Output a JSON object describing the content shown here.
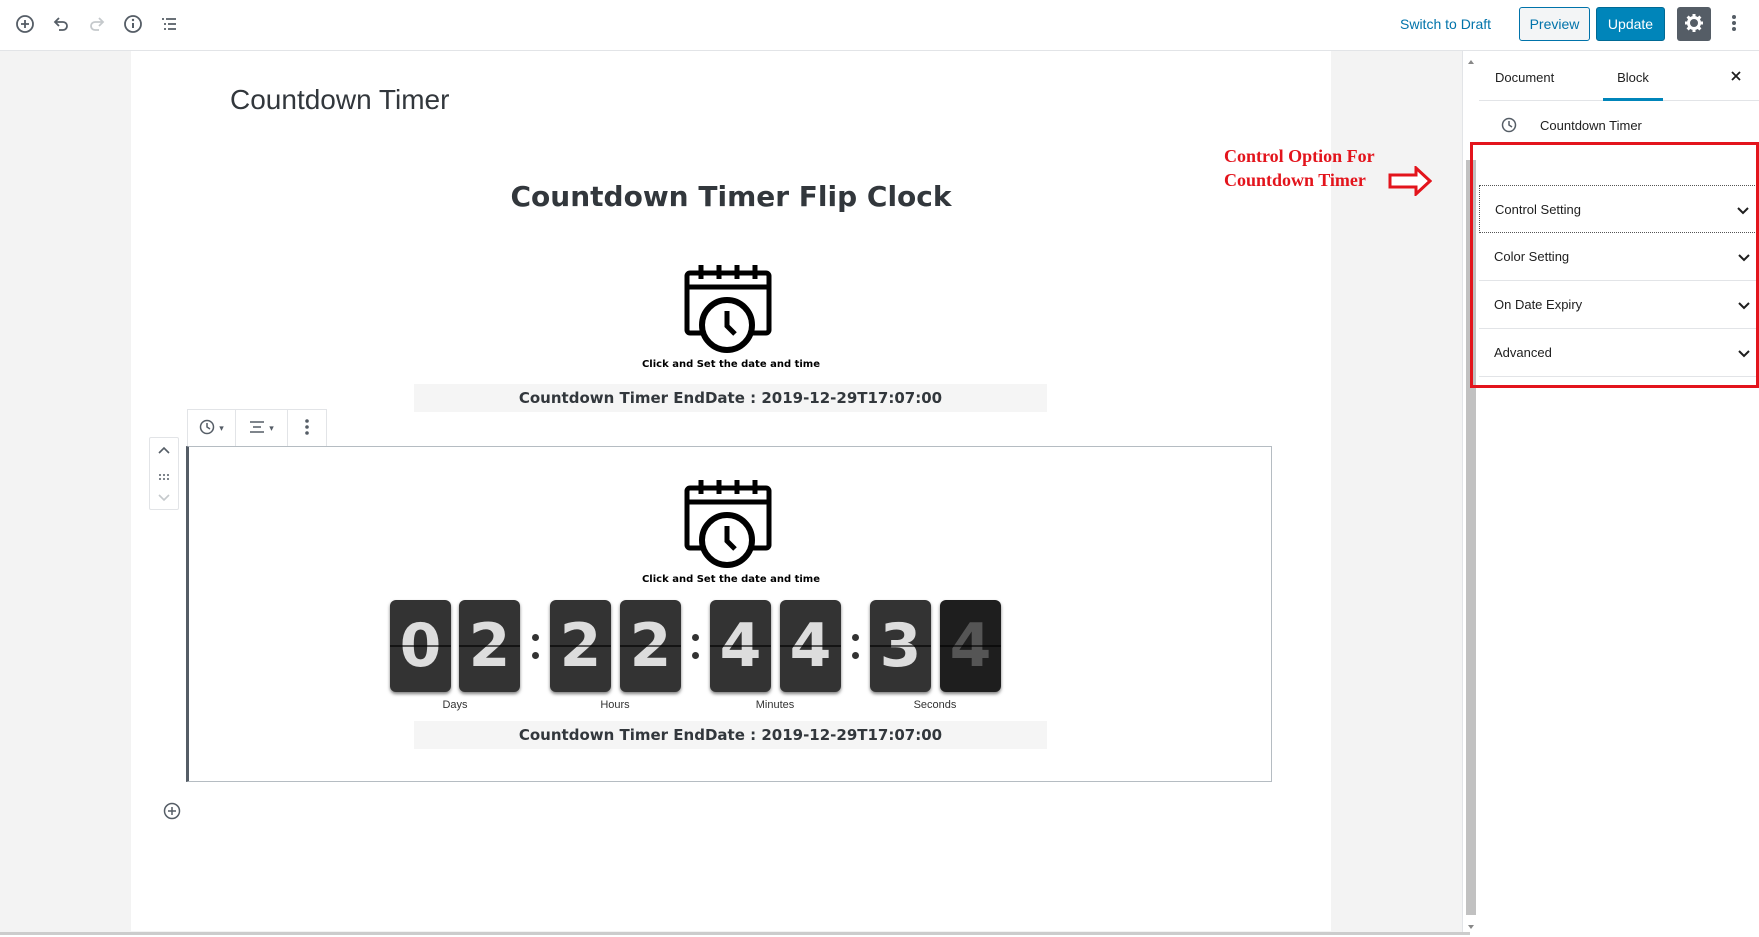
{
  "topbar": {
    "add_block_icon": "plus-circle-icon",
    "undo_icon": "undo-icon",
    "redo_icon": "redo-icon",
    "info_icon": "info-icon",
    "outline_icon": "list-outline-icon",
    "switch_to_draft": "Switch to Draft",
    "preview": "Preview",
    "update": "Update",
    "settings_icon": "gear-icon",
    "more_icon": "kebab-icon"
  },
  "editor": {
    "post_title": "Countdown Timer",
    "heading": "Countdown Timer Flip Clock",
    "block1": {
      "click_text": "Click and Set the date and time",
      "enddate": "Countdown Timer EndDate : 2019-12-29T17:07:00"
    },
    "block2": {
      "click_text": "Click and Set the date and time",
      "digits": [
        "0",
        "2",
        "2",
        "2",
        "4",
        "4",
        "3",
        "4"
      ],
      "labels": [
        "Days",
        "Hours",
        "Minutes",
        "Seconds"
      ],
      "enddate": "Countdown Timer EndDate : 2019-12-29T17:07:00"
    }
  },
  "sidebar": {
    "tabs": [
      "Document",
      "Block"
    ],
    "active_tab": "Block",
    "block_name": "Countdown Timer",
    "panels": [
      "Control Setting",
      "Color Setting",
      "On Date Expiry",
      "Advanced"
    ]
  },
  "annotation": {
    "line1": "Control Option For",
    "line2": "Countdown Timer",
    "color": "#e3141c"
  },
  "colors": {
    "accent": "#0085ba",
    "link": "#0073aa",
    "flip_bg": "#333333"
  }
}
